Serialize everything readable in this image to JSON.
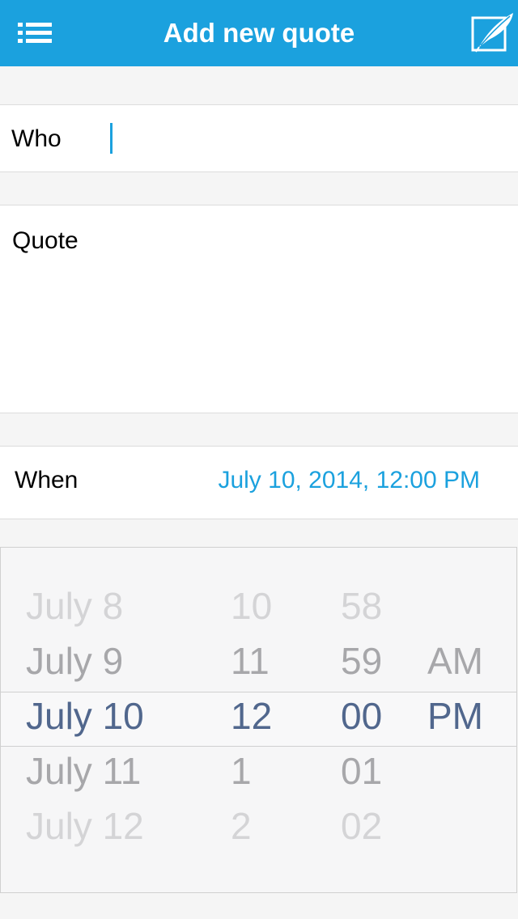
{
  "navbar": {
    "title": "Add new quote",
    "background": "#1ba1de",
    "left_icon": "menu-list-icon",
    "right_icon": "quill-compose-icon"
  },
  "form": {
    "who_label": "Who",
    "who_value": "",
    "quote_label": "Quote",
    "quote_value": "",
    "when_label": "When",
    "when_value": "July 10, 2014, 12:00 PM",
    "accent_color": "#1ba1de"
  },
  "picker": {
    "dates": [
      "July 8",
      "July 9",
      "July 10",
      "July 11",
      "July 12"
    ],
    "hours": [
      "10",
      "11",
      "12",
      "1",
      "2"
    ],
    "minutes": [
      "58",
      "59",
      "00",
      "01",
      "02"
    ],
    "ampm": [
      "AM",
      "PM"
    ],
    "selected_color": "#51678d"
  }
}
